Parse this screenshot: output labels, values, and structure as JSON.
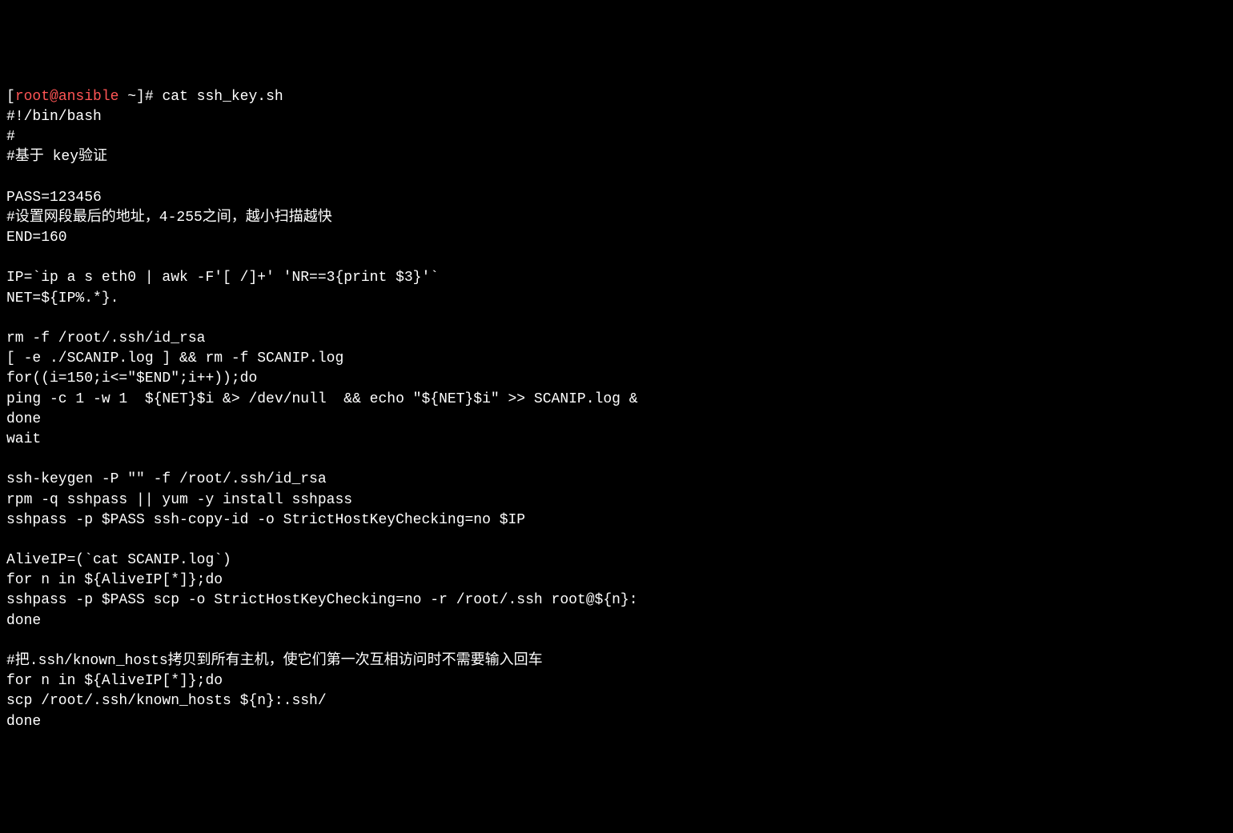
{
  "prompt": {
    "open_bracket": "[",
    "user_host": "root@ansible",
    "path": " ~",
    "close_bracket": "]",
    "symbol": "# ",
    "command": "cat ssh_key.sh"
  },
  "lines": [
    "#!/bin/bash",
    "#",
    "#基于 key验证",
    "",
    "PASS=123456",
    "#设置网段最后的地址，4-255之间，越小扫描越快",
    "END=160",
    "",
    "IP=`ip a s eth0 | awk -F'[ /]+' 'NR==3{print $3}'`",
    "NET=${IP%.*}.",
    "",
    "rm -f /root/.ssh/id_rsa",
    "[ -e ./SCANIP.log ] && rm -f SCANIP.log",
    "for((i=150;i<=\"$END\";i++));do",
    "ping -c 1 -w 1  ${NET}$i &> /dev/null  && echo \"${NET}$i\" >> SCANIP.log &",
    "done",
    "wait",
    "",
    "ssh-keygen -P \"\" -f /root/.ssh/id_rsa",
    "rpm -q sshpass || yum -y install sshpass",
    "sshpass -p $PASS ssh-copy-id -o StrictHostKeyChecking=no $IP",
    "",
    "AliveIP=(`cat SCANIP.log`)",
    "for n in ${AliveIP[*]};do",
    "sshpass -p $PASS scp -o StrictHostKeyChecking=no -r /root/.ssh root@${n}:",
    "done",
    "",
    "#把.ssh/known_hosts拷贝到所有主机，使它们第一次互相访问时不需要输入回车",
    "for n in ${AliveIP[*]};do",
    "scp /root/.ssh/known_hosts ${n}:.ssh/",
    "done"
  ]
}
